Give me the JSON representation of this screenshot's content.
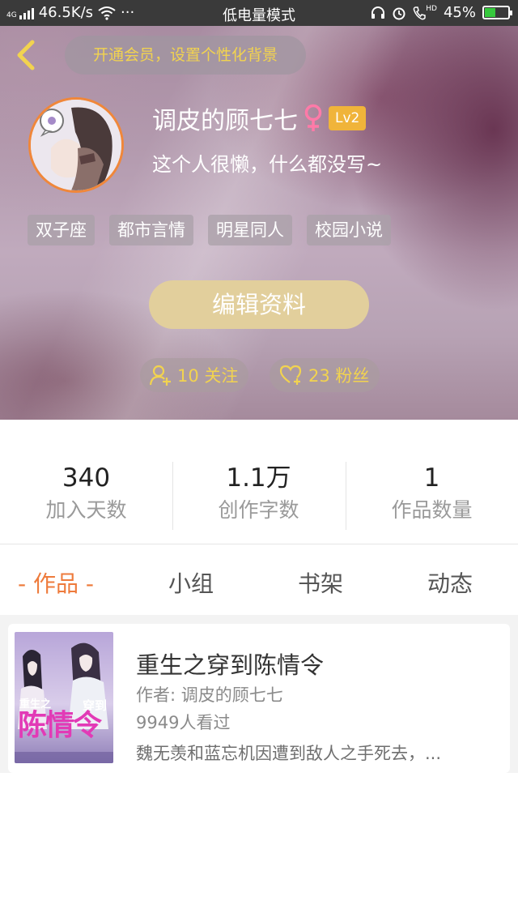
{
  "status_bar": {
    "network_type": "4G",
    "speed": "46.5K/s",
    "more": "···",
    "mode": "低电量模式",
    "hd_label": "HD",
    "battery_percent": "45%",
    "battery_level": 0.45
  },
  "header": {
    "vip_banner": "开通会员，设置个性化背景"
  },
  "profile": {
    "username": "调皮的顾七七",
    "gender_symbol": "♀",
    "level": "Lv2",
    "bio": "这个人很懒，什么都没写~",
    "tags": [
      "双子座",
      "都市言情",
      "明星同人",
      "校园小说"
    ],
    "edit_button": "编辑资料",
    "following": "10 关注",
    "fans": "23 粉丝"
  },
  "stats": [
    {
      "value": "340",
      "label": "加入天数"
    },
    {
      "value": "1.1万",
      "label": "创作字数"
    },
    {
      "value": "1",
      "label": "作品数量"
    }
  ],
  "tabs": [
    {
      "label": "- 作品 -",
      "active": true
    },
    {
      "label": "小组",
      "active": false
    },
    {
      "label": "书架",
      "active": false
    },
    {
      "label": "动态",
      "active": false
    }
  ],
  "works": [
    {
      "title": "重生之穿到陈情令",
      "author": "作者: 调皮的顾七七",
      "views": "9949人看过",
      "description": "魏无羡和蓝忘机因遭到敌人之手死去，...",
      "cover_text_top": "重生之",
      "cover_text_right": "穿到",
      "cover_text_big": "陈情令"
    }
  ],
  "colors": {
    "accent": "#ee7b3c",
    "gold_text": "#f2d34f",
    "level_badge": "#f0b43a",
    "edit_button": "#e2cf9c",
    "gender": "#ff7aa8"
  }
}
